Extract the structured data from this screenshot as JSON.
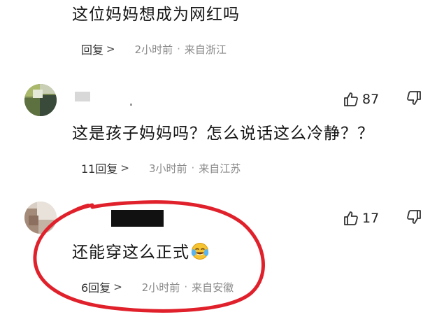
{
  "comments": [
    {
      "text": "这位妈妈想成为网红吗",
      "reply_label": "回复",
      "reply_chevron": ">",
      "time": "2小时前",
      "dot": "·",
      "location": "来自浙江"
    },
    {
      "text": "这是孩子妈妈吗？怎么说话这么冷静？？",
      "likes": "87",
      "reply_label": "11回复",
      "reply_chevron": ">",
      "time": "3小时前",
      "dot": "·",
      "location": "来自江苏"
    },
    {
      "text": "还能穿这么正式",
      "emoji": "crying-laughing-face-icon",
      "likes": "17",
      "reply_label": "6回复",
      "reply_chevron": ">",
      "time": "2小时前",
      "dot": "·",
      "location": "来自安徽"
    }
  ],
  "colors": {
    "annotation_circle": "#e0212b",
    "like_icon": "#333333",
    "meta_text": "#8a8a8a"
  },
  "icons": [
    "thumbs-up-icon",
    "thumbs-down-icon",
    "chevron-right-icon",
    "crying-laughing-face-icon"
  ]
}
